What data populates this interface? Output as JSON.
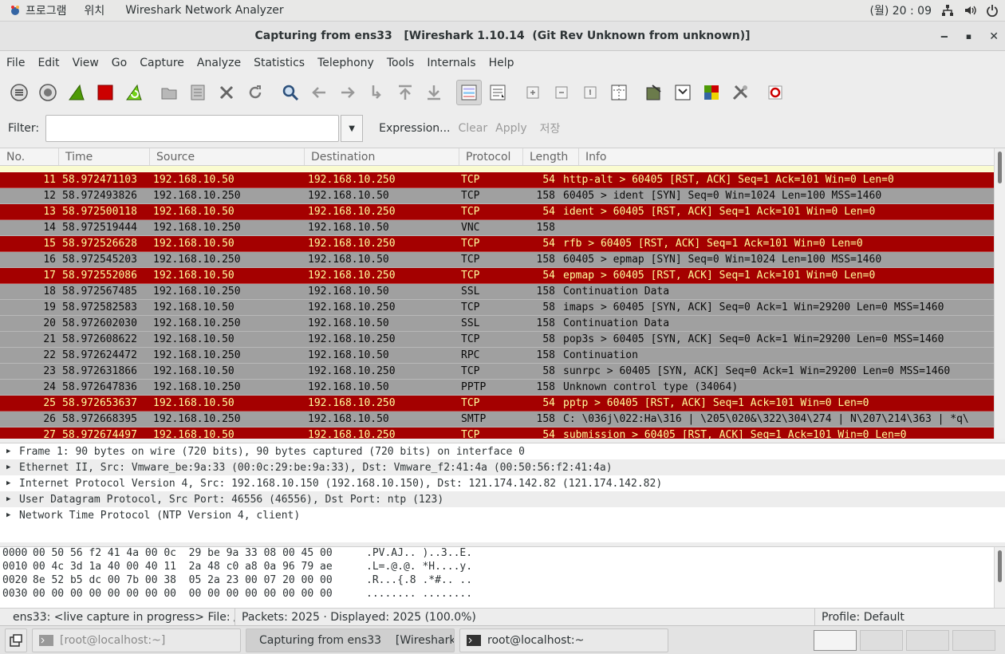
{
  "topbar": {
    "apps": "프로그램",
    "places": "위치",
    "app_name": "Wireshark Network Analyzer",
    "clock": "(월) 20 : 09"
  },
  "window": {
    "title": "Capturing from ens33   [Wireshark 1.10.14  (Git Rev Unknown from unknown)]"
  },
  "menu": [
    "File",
    "Edit",
    "View",
    "Go",
    "Capture",
    "Analyze",
    "Statistics",
    "Telephony",
    "Tools",
    "Internals",
    "Help"
  ],
  "filter": {
    "label": "Filter:",
    "value": "",
    "expression": "Expression...",
    "clear": "Clear",
    "apply": "Apply",
    "save": "저장"
  },
  "packet_columns": [
    "No.",
    "Time",
    "Source",
    "Destination",
    "Protocol",
    "Length",
    "Info"
  ],
  "packets": [
    {
      "no": "11",
      "time": "58.972471103",
      "src": "192.168.10.50",
      "dst": "192.168.10.250",
      "proto": "TCP",
      "len": "54",
      "info": "http-alt > 60405 [RST, ACK] Seq=1 Ack=101 Win=0 Len=0",
      "color": "red"
    },
    {
      "no": "12",
      "time": "58.972493826",
      "src": "192.168.10.250",
      "dst": "192.168.10.50",
      "proto": "TCP",
      "len": "158",
      "info": "60405 > ident [SYN] Seq=0 Win=1024 Len=100 MSS=1460",
      "color": "gray"
    },
    {
      "no": "13",
      "time": "58.972500118",
      "src": "192.168.10.50",
      "dst": "192.168.10.250",
      "proto": "TCP",
      "len": "54",
      "info": "ident > 60405 [RST, ACK] Seq=1 Ack=101 Win=0 Len=0",
      "color": "red"
    },
    {
      "no": "14",
      "time": "58.972519444",
      "src": "192.168.10.250",
      "dst": "192.168.10.50",
      "proto": "VNC",
      "len": "158",
      "info": "",
      "color": "gray"
    },
    {
      "no": "15",
      "time": "58.972526628",
      "src": "192.168.10.50",
      "dst": "192.168.10.250",
      "proto": "TCP",
      "len": "54",
      "info": "rfb > 60405 [RST, ACK] Seq=1 Ack=101 Win=0 Len=0",
      "color": "red"
    },
    {
      "no": "16",
      "time": "58.972545203",
      "src": "192.168.10.250",
      "dst": "192.168.10.50",
      "proto": "TCP",
      "len": "158",
      "info": "60405 > epmap [SYN] Seq=0 Win=1024 Len=100 MSS=1460",
      "color": "gray"
    },
    {
      "no": "17",
      "time": "58.972552086",
      "src": "192.168.10.50",
      "dst": "192.168.10.250",
      "proto": "TCP",
      "len": "54",
      "info": "epmap > 60405 [RST, ACK] Seq=1 Ack=101 Win=0 Len=0",
      "color": "red"
    },
    {
      "no": "18",
      "time": "58.972567485",
      "src": "192.168.10.250",
      "dst": "192.168.10.50",
      "proto": "SSL",
      "len": "158",
      "info": "Continuation Data",
      "color": "gray"
    },
    {
      "no": "19",
      "time": "58.972582583",
      "src": "192.168.10.50",
      "dst": "192.168.10.250",
      "proto": "TCP",
      "len": "58",
      "info": "imaps > 60405 [SYN, ACK] Seq=0 Ack=1 Win=29200 Len=0 MSS=1460",
      "color": "gray"
    },
    {
      "no": "20",
      "time": "58.972602030",
      "src": "192.168.10.250",
      "dst": "192.168.10.50",
      "proto": "SSL",
      "len": "158",
      "info": "Continuation Data",
      "color": "gray"
    },
    {
      "no": "21",
      "time": "58.972608622",
      "src": "192.168.10.50",
      "dst": "192.168.10.250",
      "proto": "TCP",
      "len": "58",
      "info": "pop3s > 60405 [SYN, ACK] Seq=0 Ack=1 Win=29200 Len=0 MSS=1460",
      "color": "gray"
    },
    {
      "no": "22",
      "time": "58.972624472",
      "src": "192.168.10.250",
      "dst": "192.168.10.50",
      "proto": "RPC",
      "len": "158",
      "info": "Continuation",
      "color": "gray"
    },
    {
      "no": "23",
      "time": "58.972631866",
      "src": "192.168.10.50",
      "dst": "192.168.10.250",
      "proto": "TCP",
      "len": "58",
      "info": "sunrpc > 60405 [SYN, ACK] Seq=0 Ack=1 Win=29200 Len=0 MSS=1460",
      "color": "gray"
    },
    {
      "no": "24",
      "time": "58.972647836",
      "src": "192.168.10.250",
      "dst": "192.168.10.50",
      "proto": "PPTP",
      "len": "158",
      "info": "Unknown control type (34064)",
      "color": "gray"
    },
    {
      "no": "25",
      "time": "58.972653637",
      "src": "192.168.10.50",
      "dst": "192.168.10.250",
      "proto": "TCP",
      "len": "54",
      "info": "pptp > 60405 [RST, ACK] Seq=1 Ack=101 Win=0 Len=0",
      "color": "red"
    },
    {
      "no": "26",
      "time": "58.972668395",
      "src": "192.168.10.250",
      "dst": "192.168.10.50",
      "proto": "SMTP",
      "len": "158",
      "info": "C: \\036j\\022:Ha\\316 | \\205\\020&\\322\\304\\274 | N\\207\\214\\363 | *q\\",
      "color": "gray"
    },
    {
      "no": "27",
      "time": "58.972674497",
      "src": "192.168.10.50",
      "dst": "192.168.10.250",
      "proto": "TCP",
      "len": "54",
      "info": "submission > 60405 [RST, ACK] Seq=1 Ack=101 Win=0 Len=0",
      "color": "red"
    }
  ],
  "details": [
    "Frame 1: 90 bytes on wire (720 bits), 90 bytes captured (720 bits) on interface 0",
    "Ethernet II, Src: Vmware_be:9a:33 (00:0c:29:be:9a:33), Dst: Vmware_f2:41:4a (00:50:56:f2:41:4a)",
    "Internet Protocol Version 4, Src: 192.168.10.150 (192.168.10.150), Dst: 121.174.142.82 (121.174.142.82)",
    "User Datagram Protocol, Src Port: 46556 (46556), Dst Port: ntp (123)",
    "Network Time Protocol (NTP Version 4, client)"
  ],
  "hex": [
    {
      "off": "0000",
      "bytes": "00 50 56 f2 41 4a 00 0c  29 be 9a 33 08 00 45 00",
      "ascii": ".PV.AJ.. )..3..E."
    },
    {
      "off": "0010",
      "bytes": "00 4c 3d 1a 40 00 40 11  2a 48 c0 a8 0a 96 79 ae",
      "ascii": ".L=.@.@. *H....y."
    },
    {
      "off": "0020",
      "bytes": "8e 52 b5 dc 00 7b 00 38  05 2a 23 00 07 20 00 00",
      "ascii": ".R...{.8 .*#.. .."
    },
    {
      "off": "0030",
      "bytes": "00 00 00 00 00 00 00 00  00 00 00 00 00 00 00 00",
      "ascii": "........ ........"
    }
  ],
  "status": {
    "capture": "ens33: <live capture in progress> File: /",
    "packets": "Packets: 2025 · Displayed: 2025 (100.0%)",
    "profile": "Profile: Default"
  },
  "taskbar": {
    "t1": "[root@localhost:~]",
    "t2": "Capturing from ens33    [Wireshark ...",
    "t3": "root@localhost:~"
  },
  "colors": {
    "red_row": "#a40000",
    "gray_row": "#a0a0a0",
    "yellow_row": "#fafbd0"
  }
}
